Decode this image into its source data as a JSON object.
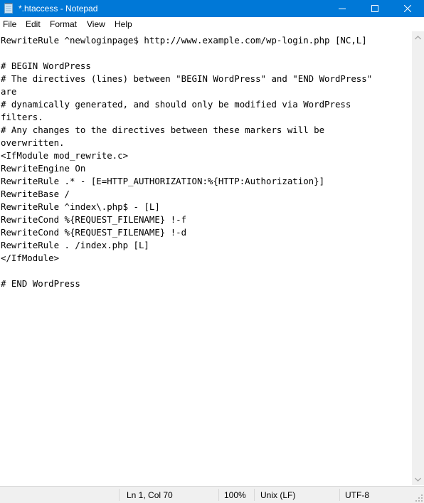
{
  "window": {
    "title": "*.htaccess - Notepad",
    "icon": "notepad-icon",
    "controls": {
      "minimize": "minimize-icon",
      "maximize": "maximize-icon",
      "close": "close-icon"
    },
    "accent_color": "#0078d7"
  },
  "menu": {
    "items": [
      {
        "label": "File"
      },
      {
        "label": "Edit"
      },
      {
        "label": "Format"
      },
      {
        "label": "View"
      },
      {
        "label": "Help"
      }
    ]
  },
  "editor": {
    "content": "RewriteRule ^newloginpage$ http://www.example.com/wp-login.php [NC,L]\n\n# BEGIN WordPress\n# The directives (lines) between \"BEGIN WordPress\" and \"END WordPress\"\nare\n# dynamically generated, and should only be modified via WordPress\nfilters.\n# Any changes to the directives between these markers will be\noverwritten.\n<IfModule mod_rewrite.c>\nRewriteEngine On\nRewriteRule .* - [E=HTTP_AUTHORIZATION:%{HTTP:Authorization}]\nRewriteBase /\nRewriteRule ^index\\.php$ - [L]\nRewriteCond %{REQUEST_FILENAME} !-f\nRewriteCond %{REQUEST_FILENAME} !-d\nRewriteRule . /index.php [L]\n</IfModule>\n\n# END WordPress"
  },
  "statusbar": {
    "position": "Ln 1, Col 70",
    "zoom": "100%",
    "line_ending": "Unix (LF)",
    "encoding": "UTF-8"
  }
}
